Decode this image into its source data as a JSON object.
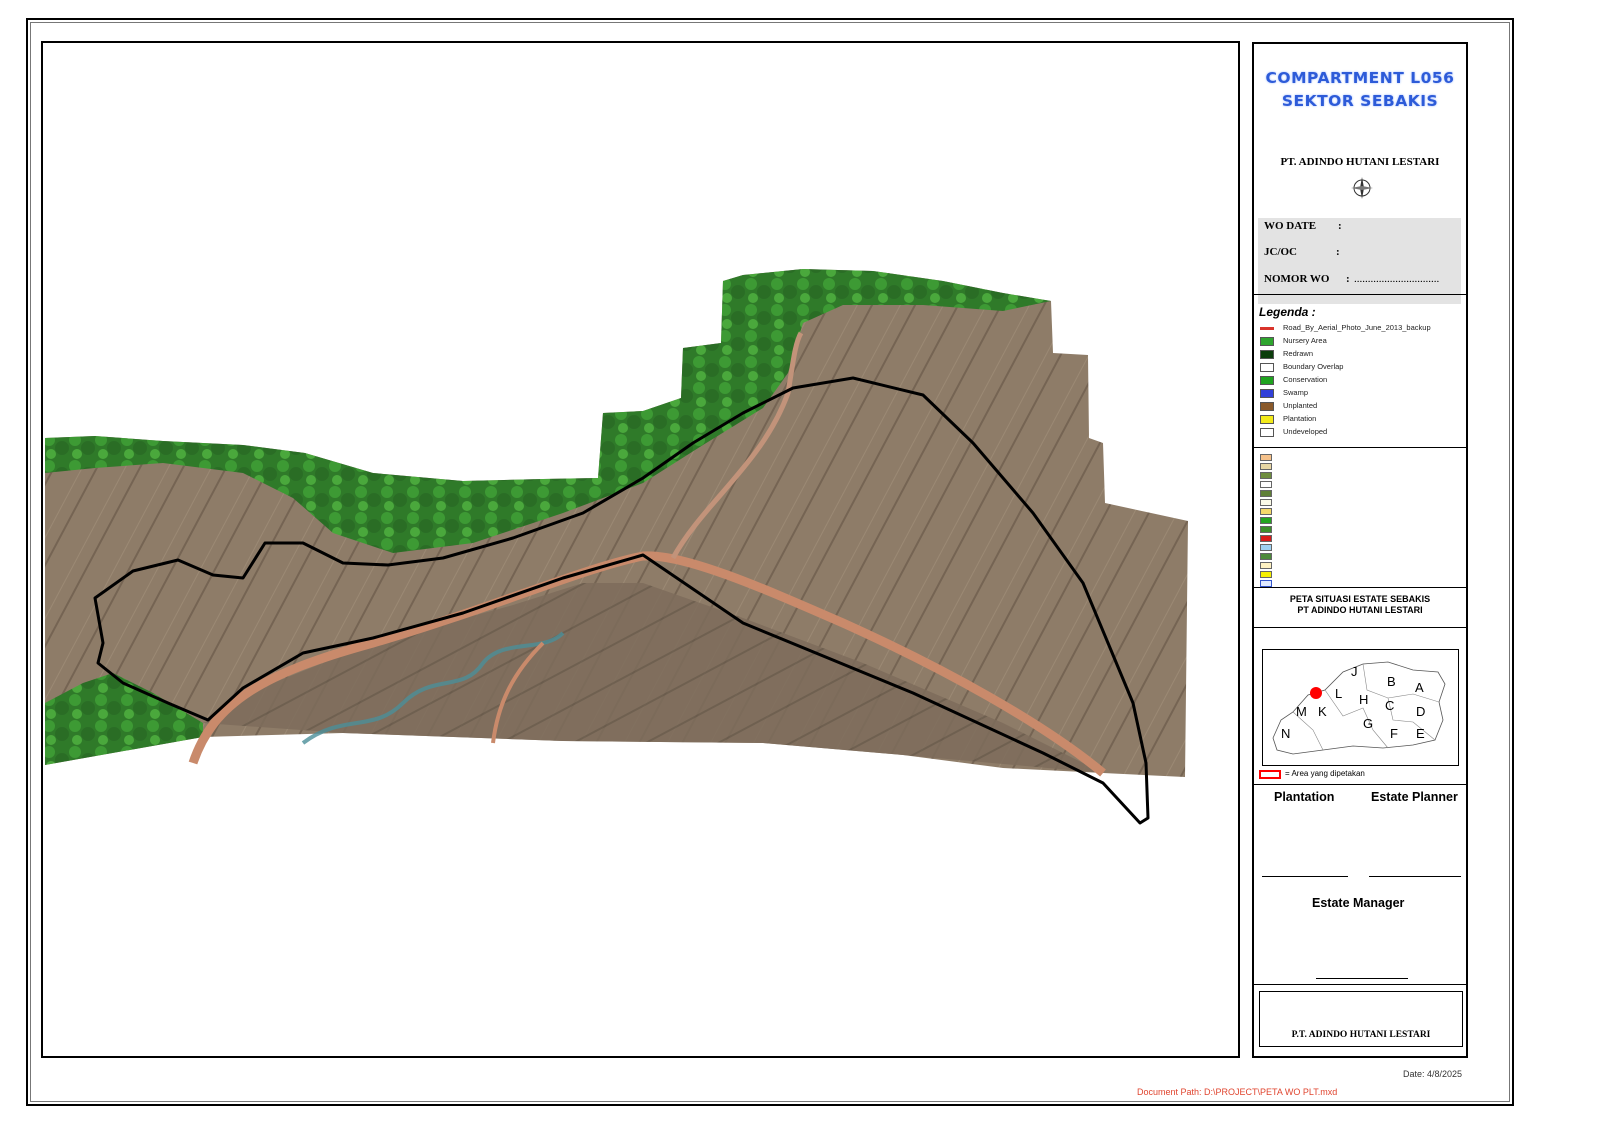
{
  "panel": {
    "title_line1": "COMPARTMENT L056",
    "title_line2": "SEKTOR SEBAKIS",
    "company": "PT. ADINDO HUTANI LESTARI",
    "wo_date_label": "WO DATE",
    "jc_oc_label": "JC/OC",
    "nomor_wo_label": "NOMOR WO",
    "colon": ":",
    "nomor_wo_value": "...............................",
    "legend_title": "Legenda :",
    "legend_items": [
      {
        "label": "Road_By_Aerial_Photo_June_2013_backup",
        "color": "#d9342b"
      },
      {
        "label": "Nursery Area",
        "color": "#2ea52e"
      },
      {
        "label": "Redrawn",
        "color": "#0b3d0b"
      },
      {
        "label": "Boundary Overlap",
        "color": "#ffffff"
      },
      {
        "label": "Conservation",
        "color": "#1fa31f"
      },
      {
        "label": "Swamp",
        "color": "#3140d8"
      },
      {
        "label": "Unplanted",
        "color": "#8a5a2b"
      },
      {
        "label": "Plantation",
        "color": "#f2ea1a"
      },
      {
        "label": "Undeveloped",
        "color": "#ffffff"
      }
    ],
    "peta_line1": "PETA SITUASI ESTATE SEBAKIS",
    "peta_line2": "PT ADINDO HUTANI LESTARI",
    "inset_labels": [
      "J",
      "B",
      "A",
      "L",
      "H",
      "C",
      "D",
      "M",
      "K",
      "G",
      "F",
      "E",
      "N"
    ],
    "area_note": "= Area yang dipetakan",
    "plantation": "Plantation",
    "estate_planner": "Estate Planner",
    "estate_manager": "Estate Manager",
    "footer_company": "P.T. ADINDO HUTANI LESTARI"
  },
  "footer": {
    "date": "Date: 4/8/2025",
    "doc_path": "Document Path: D:\\PROJECT\\PETA WO PLT.mxd"
  },
  "colors": {
    "title_blue": "#2d5bd8",
    "vegetation": "#2f7d2a",
    "bare_soil": "#8f7e6a",
    "road": "#c98a6b",
    "boundary": "#000000",
    "location_marker": "#ff0000"
  }
}
